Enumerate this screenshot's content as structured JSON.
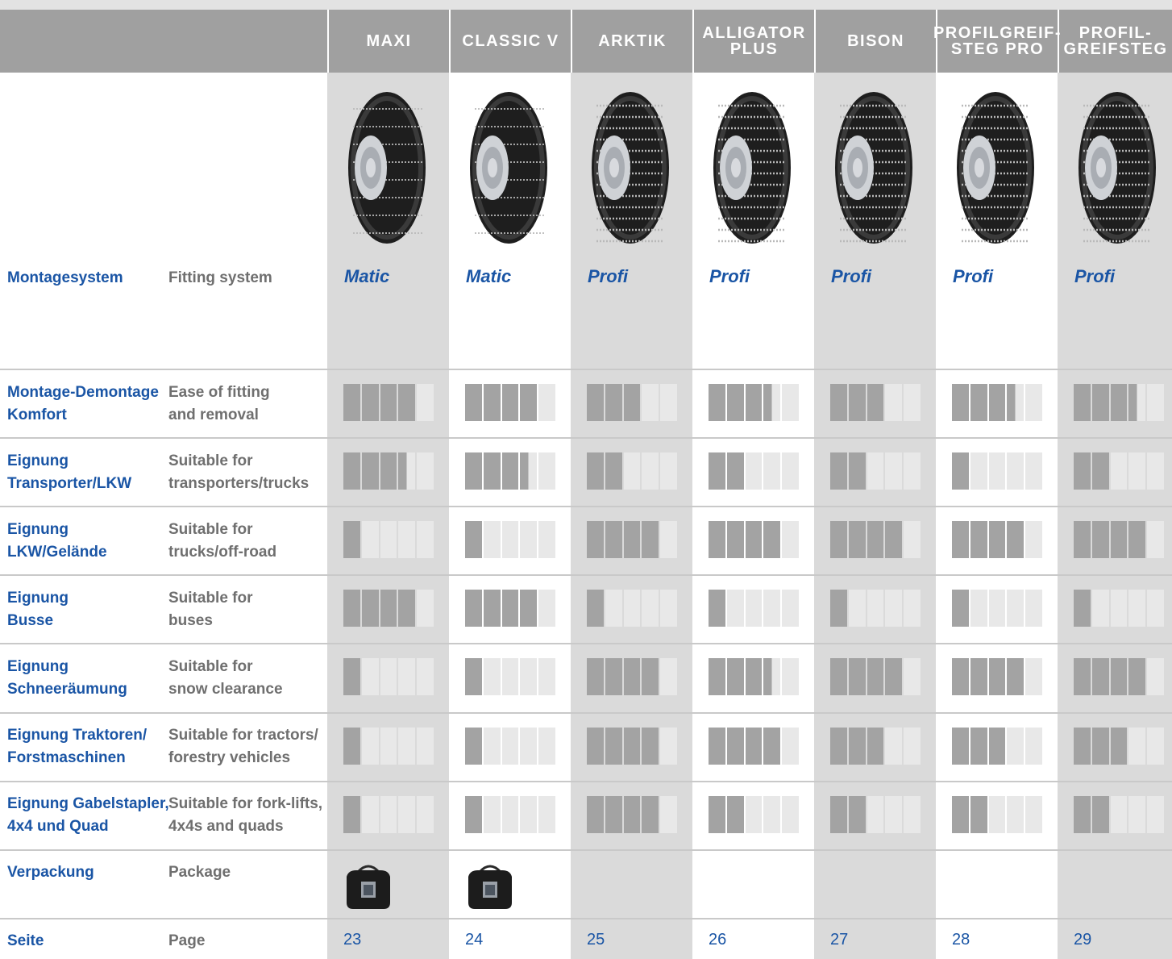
{
  "products": [
    {
      "name": "MAXI",
      "system": "Matic",
      "page": "23",
      "ratings": [
        4,
        3.5,
        1,
        4,
        1,
        1,
        1
      ],
      "has_package": true
    },
    {
      "name": "CLASSIC V",
      "system": "Matic",
      "page": "24",
      "ratings": [
        4,
        3.5,
        1,
        4,
        1,
        1,
        1
      ],
      "has_package": true
    },
    {
      "name": "ARKTIK",
      "system": "Profi",
      "page": "25",
      "ratings": [
        3,
        2,
        4,
        1,
        4,
        4,
        4
      ],
      "has_package": false
    },
    {
      "name": "ALLIGATOR\nPLUS",
      "system": "Profi",
      "page": "26",
      "ratings": [
        3.5,
        2,
        4,
        1,
        3.5,
        4,
        2
      ],
      "has_package": false
    },
    {
      "name": "BISON",
      "system": "Profi",
      "page": "27",
      "ratings": [
        3,
        2,
        4,
        1,
        4,
        3,
        2
      ],
      "has_package": false
    },
    {
      "name": "PROFILGREIF-\nSTEG PRO",
      "system": "Profi",
      "page": "28",
      "ratings": [
        3.5,
        1,
        4,
        1,
        4,
        3,
        2
      ],
      "has_package": false
    },
    {
      "name": "PROFIL-\nGREIFSTEG",
      "system": "Profi",
      "page": "29",
      "ratings": [
        3.5,
        2,
        4,
        1,
        4,
        3,
        2
      ],
      "has_package": false
    }
  ],
  "rows": {
    "fitting_system": {
      "de": "Montagesystem",
      "en": "Fitting system"
    },
    "criteria": [
      {
        "de": "Montage-Demontage\nKomfort",
        "en": "Ease of fitting\nand removal"
      },
      {
        "de": "Eignung\nTransporter/LKW",
        "en": "Suitable for\ntransporters/trucks"
      },
      {
        "de": "Eignung\nLKW/Gelände",
        "en": "Suitable for\ntrucks/off-road"
      },
      {
        "de": "Eignung\nBusse",
        "en": "Suitable for\nbuses"
      },
      {
        "de": "Eignung\nSchneeräumung",
        "en": "Suitable for\nsnow clearance"
      },
      {
        "de": "Eignung Traktoren/\nForstmaschinen",
        "en": "Suitable for tractors/\nforestry vehicles"
      },
      {
        "de": "Eignung Gabelstapler,\n4x4 und Quad",
        "en": "Suitable for fork-lifts,\n4x4s and quads"
      }
    ],
    "package": {
      "de": "Verpackung",
      "en": "Package"
    },
    "page": {
      "de": "Seite",
      "en": "Page"
    }
  },
  "rating_scale_max": 5,
  "colors": {
    "brand_blue": "#1a55a5",
    "header_grey": "#a0a0a0",
    "bar_on": "#a3a3a3",
    "bar_off": "#e8e8e8",
    "col_grey": "#dadada"
  }
}
